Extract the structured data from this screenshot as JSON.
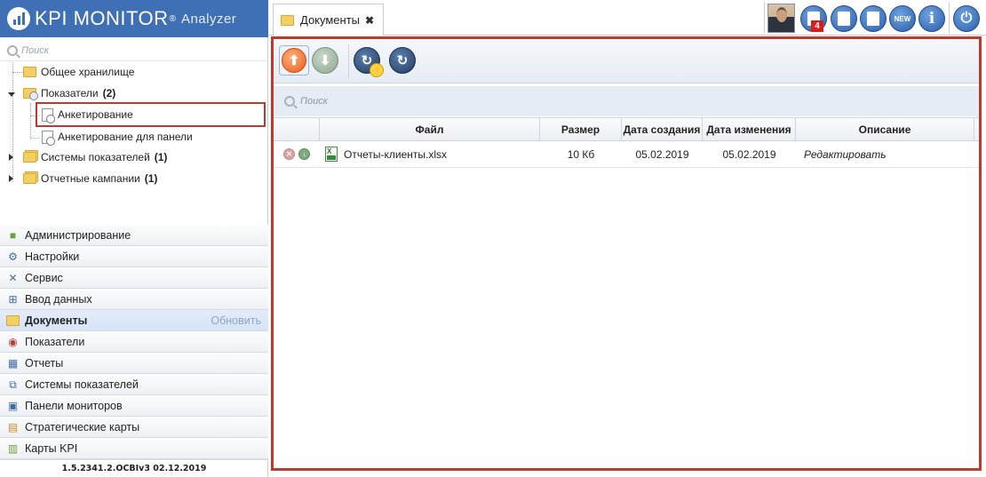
{
  "app": {
    "logo_title": "KPI MONITOR",
    "logo_reg": "®",
    "logo_subtitle": "Analyzer",
    "version": "1.5.2341.2.OCBIv3  02.12.2019"
  },
  "left_search": {
    "placeholder": "Поиск"
  },
  "tree": {
    "shared_storage": "Общее хранилище",
    "indicators": {
      "label": "Показатели",
      "count": "(2)"
    },
    "child_survey": "Анкетирование",
    "child_survey_panel": "Анкетирование для панели",
    "indicator_systems": {
      "label": "Системы показателей",
      "count": "(1)"
    },
    "report_campaigns": {
      "label": "Отчетные кампании",
      "count": "(1)"
    }
  },
  "menu": {
    "items": [
      {
        "label": "Администрирование",
        "icon": "cube-icon"
      },
      {
        "label": "Настройки",
        "icon": "gear-icon"
      },
      {
        "label": "Сервис",
        "icon": "tools-icon"
      },
      {
        "label": "Ввод данных",
        "icon": "data-entry-icon"
      },
      {
        "label": "Документы",
        "icon": "folder-icon",
        "active": true,
        "refresh": "Обновить"
      },
      {
        "label": "Показатели",
        "icon": "gauge-icon"
      },
      {
        "label": "Отчеты",
        "icon": "table-icon"
      },
      {
        "label": "Системы показателей",
        "icon": "hierarchy-icon"
      },
      {
        "label": "Панели мониторов",
        "icon": "dashboard-icon"
      },
      {
        "label": "Стратегические карты",
        "icon": "strategy-map-icon"
      },
      {
        "label": "Карты KPI",
        "icon": "kpi-map-icon"
      }
    ]
  },
  "tab": {
    "label": "Документы",
    "close": "✖"
  },
  "topbar": {
    "notification_count": "4",
    "buttons": [
      "tasks-icon",
      "report-icon",
      "clipboard-icon",
      "new-icon",
      "info-icon",
      "power-icon"
    ],
    "new_label": "NEW",
    "info_label": "i"
  },
  "main_search": {
    "placeholder": "Поиск"
  },
  "grid": {
    "columns": [
      "Файл",
      "Размер",
      "Дата создания",
      "Дата изменения",
      "Описание"
    ],
    "rows": [
      {
        "file": "Отчеты-клиенты.xlsx",
        "size": "10 Кб",
        "created": "05.02.2019",
        "modified": "05.02.2019",
        "description": "Редактировать"
      }
    ]
  },
  "colors": {
    "accent": "#3f6fb5",
    "highlight_border": "#c0392b",
    "upload": "#e85d1c"
  }
}
